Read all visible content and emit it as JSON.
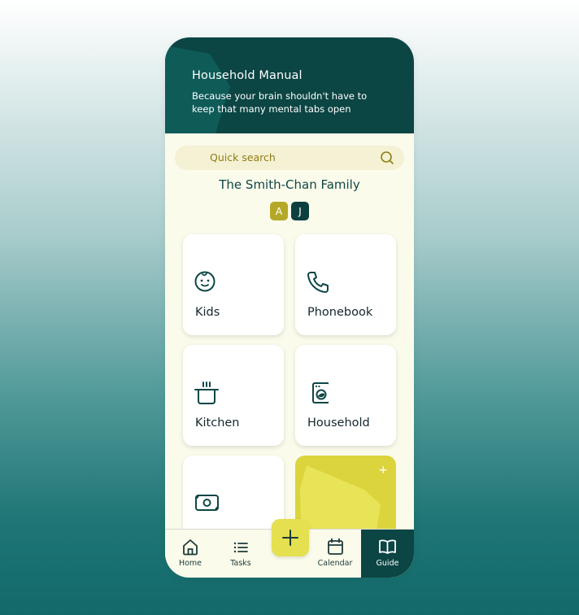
{
  "header": {
    "title": "Household Manual",
    "subtitle": "Because your brain shouldn't have to keep that many mental tabs open"
  },
  "search": {
    "placeholder": "Quick search"
  },
  "family": {
    "name": "The Smith-Chan Family",
    "members": [
      "A",
      "J"
    ]
  },
  "cards": [
    {
      "label": "Kids",
      "icon": "baby-face-icon"
    },
    {
      "label": "Phonebook",
      "icon": "phone-icon"
    },
    {
      "label": "Kitchen",
      "icon": "cooking-pot-icon"
    },
    {
      "label": "Household",
      "icon": "washing-machine-icon"
    },
    {
      "label": "",
      "icon": "money-icon"
    },
    {
      "label": "",
      "icon": "add-icon"
    }
  ],
  "add_card": {
    "plus": "+"
  },
  "nav": {
    "home": "Home",
    "tasks": "Tasks",
    "calendar": "Calendar",
    "guide": "Guide"
  },
  "colors": {
    "header_bg": "#0b4544",
    "accent_yellow": "#dbd43d",
    "page_bg": "#fbfbeb",
    "text_dark": "#0f4746"
  }
}
